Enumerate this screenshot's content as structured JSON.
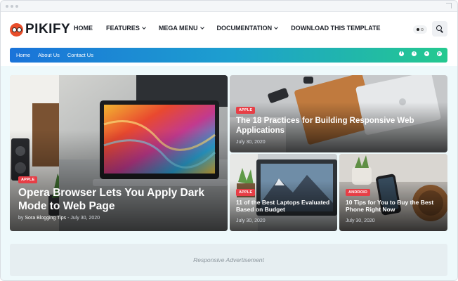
{
  "brand": {
    "name": "PIKIFY"
  },
  "nav": {
    "items": [
      {
        "label": "HOME",
        "dropdown": false
      },
      {
        "label": "FEATURES",
        "dropdown": true
      },
      {
        "label": "MEGA MENU",
        "dropdown": true
      },
      {
        "label": "DOCUMENTATION",
        "dropdown": true
      },
      {
        "label": "DOWNLOAD THIS TEMPLATE",
        "dropdown": false
      }
    ]
  },
  "menubar": {
    "links": [
      "Home",
      "About Us",
      "Contact Us"
    ],
    "socials": [
      {
        "icon": "facebook-icon",
        "glyph": "f"
      },
      {
        "icon": "twitter-icon",
        "glyph": "t"
      },
      {
        "icon": "youtube-icon",
        "glyph": "▸"
      },
      {
        "icon": "pinterest-icon",
        "glyph": "p"
      }
    ]
  },
  "featured": [
    {
      "badge": "APPLE",
      "title": "Opera Browser Lets You Apply Dark Mode to Web Page",
      "author_prefix": "by",
      "author": "Sora Blogging Tips",
      "separator": "-",
      "date": "July 30, 2020"
    },
    {
      "badge": "APPLE",
      "title": "The 18 Practices for Building Responsive Web Applications",
      "date": "July 30, 2020"
    },
    {
      "badge": "APPLE",
      "title": "11 of the Best Laptops Evaluated Based on Budget",
      "date": "July 30, 2020"
    },
    {
      "badge": "ANDROID",
      "title": "10 Tips for You to Buy the Best Phone Right Now",
      "date": "July 30, 2020"
    }
  ],
  "ad": {
    "label": "Responsive Advertisement"
  },
  "colors": {
    "accent": "#e73e46",
    "menubar_start": "#1a73d9",
    "menubar_end": "#24c98f",
    "logo": "#e94e2b"
  }
}
